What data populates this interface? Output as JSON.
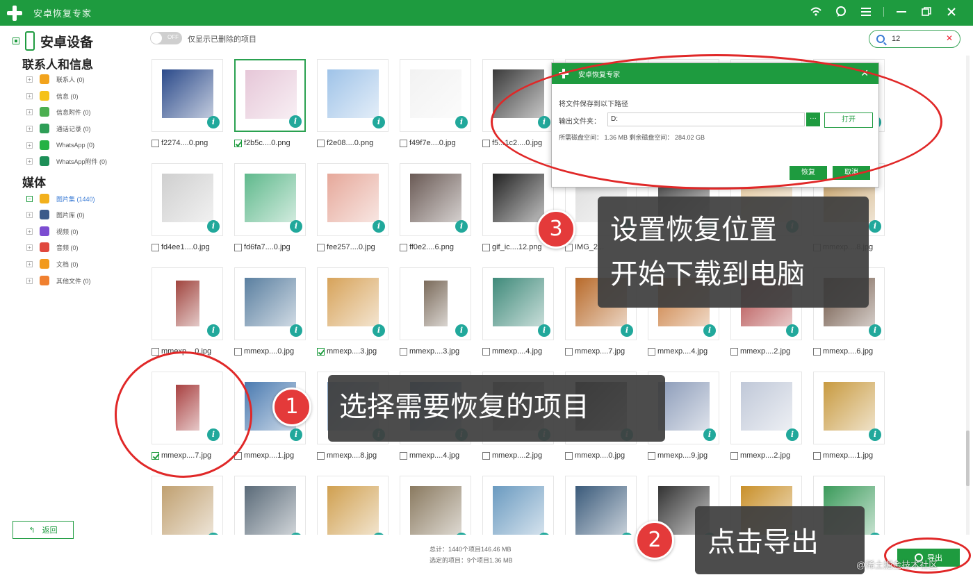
{
  "app": {
    "title": "安卓恢复专家",
    "icons": [
      "wifi-icon",
      "chat-icon",
      "menu-icon",
      "minimize-icon",
      "restore-icon",
      "close-icon"
    ]
  },
  "sidebar": {
    "device_label": "安卓设备",
    "section_contacts": "联系人和信息",
    "section_media": "媒体",
    "contacts_items": [
      {
        "label": "联系人 (0)",
        "color": "#f2a31c"
      },
      {
        "label": "信息 (0)",
        "color": "#f5c21a"
      },
      {
        "label": "信息附件 (0)",
        "color": "#4caf50"
      },
      {
        "label": "通话记录 (0)",
        "color": "#2e9e57"
      },
      {
        "label": "WhatsApp (0)",
        "color": "#25b244"
      },
      {
        "label": "WhatsApp附件 (0)",
        "color": "#1d8f58"
      }
    ],
    "media_items": [
      {
        "label": "图片集 (1440)",
        "color": "#f2b01c",
        "active": true
      },
      {
        "label": "图片库 (0)",
        "color": "#3b5a8a"
      },
      {
        "label": "视频 (0)",
        "color": "#7c4dd1"
      },
      {
        "label": "音频 (0)",
        "color": "#e0483e"
      },
      {
        "label": "文档 (0)",
        "color": "#f29a1c"
      },
      {
        "label": "其他文件 (0)",
        "color": "#f08030"
      }
    ],
    "back_label": "返回"
  },
  "toolbar": {
    "toggle_state": "OFF",
    "toggle_label": "仅显示已删除的项目",
    "search_value": "12"
  },
  "files": [
    {
      "name": "f2274....0.png",
      "checked": false,
      "selected": false
    },
    {
      "name": "f2b5c....0.png",
      "checked": true,
      "selected": true
    },
    {
      "name": "f2e08....0.png",
      "checked": false,
      "selected": false
    },
    {
      "name": "f49f7e....0.jpg",
      "checked": false,
      "selected": false
    },
    {
      "name": "f5...1c2....0.jpg",
      "checked": false,
      "selected": false
    },
    {
      "name": "",
      "checked": false,
      "selected": false
    },
    {
      "name": "",
      "checked": false,
      "selected": false
    },
    {
      "name": "",
      "checked": false,
      "selected": false
    },
    {
      "name": "",
      "checked": false,
      "selected": false
    },
    {
      "name": "fd4ee1....0.jpg",
      "checked": false,
      "selected": false
    },
    {
      "name": "fd6fa7....0.jpg",
      "checked": false,
      "selected": false
    },
    {
      "name": "fee257....0.jpg",
      "checked": false,
      "selected": false
    },
    {
      "name": "ff0e2....6.png",
      "checked": false,
      "selected": false
    },
    {
      "name": "gif_ic....12.png",
      "checked": false,
      "selected": false
    },
    {
      "name": "IMG_2...",
      "checked": false,
      "selected": false
    },
    {
      "name": "",
      "checked": false,
      "selected": false
    },
    {
      "name": "",
      "checked": false,
      "selected": false
    },
    {
      "name": "mmexp....8.jpg",
      "checked": false,
      "selected": false
    },
    {
      "name": "mmexp....0.jpg",
      "checked": false,
      "selected": false
    },
    {
      "name": "mmexp....0.jpg",
      "checked": false,
      "selected": false
    },
    {
      "name": "mmexp....3.jpg",
      "checked": true,
      "selected": false
    },
    {
      "name": "mmexp....3.jpg",
      "checked": false,
      "selected": false
    },
    {
      "name": "mmexp....4.jpg",
      "checked": false,
      "selected": false
    },
    {
      "name": "mmexp....7.jpg",
      "checked": false,
      "selected": false
    },
    {
      "name": "mmexp....4.jpg",
      "checked": false,
      "selected": false
    },
    {
      "name": "mmexp....2.jpg",
      "checked": false,
      "selected": false
    },
    {
      "name": "mmexp....6.jpg",
      "checked": false,
      "selected": false
    },
    {
      "name": "mmexp....7.jpg",
      "checked": true,
      "selected": false
    },
    {
      "name": "mmexp....1.jpg",
      "checked": false,
      "selected": false
    },
    {
      "name": "mmexp....8.jpg",
      "checked": false,
      "selected": false
    },
    {
      "name": "mmexp....4.jpg",
      "checked": false,
      "selected": false
    },
    {
      "name": "mmexp....2.jpg",
      "checked": false,
      "selected": false
    },
    {
      "name": "mmexp....0.jpg",
      "checked": false,
      "selected": false
    },
    {
      "name": "mmexp....9.jpg",
      "checked": false,
      "selected": false
    },
    {
      "name": "mmexp....2.jpg",
      "checked": false,
      "selected": false
    },
    {
      "name": "mmexp....1.jpg",
      "checked": false,
      "selected": false
    }
  ],
  "status": {
    "total": "总计：1440个项目146.46 MB",
    "selected": "选定的项目：9个项目1.36 MB"
  },
  "export_label": "导出",
  "dialog": {
    "title": "安卓恢复专家",
    "save_text": "将文件保存到以下路径",
    "path_label": "输出文件夹：",
    "path_value": "D:",
    "browse_label": "···",
    "open_label": "打开",
    "space_text": "所需磁盘空间：   1.36 MB    剩余磁盘空间：   284.02 GB",
    "recover_label": "恢复",
    "cancel_label": "取消"
  },
  "tutorial": {
    "step1_num": "1",
    "step1_text": "选择需要恢复的项目",
    "step2_num": "2",
    "step2_text": "点击导出",
    "step3_num": "3",
    "step3_line1": "设置恢复位置",
    "step3_line2": "开始下载到电脑"
  },
  "watermark": "@稀土掘金技术社区"
}
